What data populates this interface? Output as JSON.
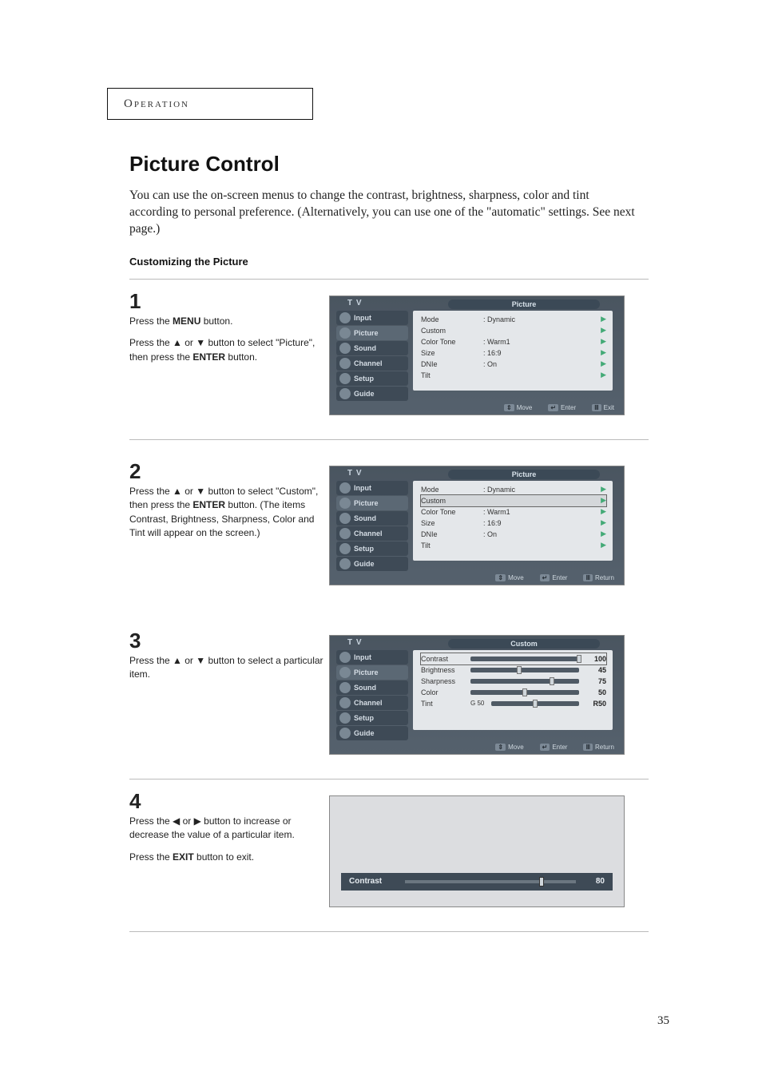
{
  "header": {
    "section": "Operation"
  },
  "title": "Picture Control",
  "intro": "You can use the on-screen menus to change the contrast, brightness, sharpness, color and tint according to personal preference. (Alternatively, you can use one of the \"automatic\" settings. See next page.)",
  "subhead": "Customizing the Picture",
  "page_number": "35",
  "symbols": {
    "up": "▲",
    "down": "▼",
    "left": "◀",
    "right": "▶",
    "play": "▶"
  },
  "sidebar": {
    "items": [
      {
        "label": "Input"
      },
      {
        "label": "Picture"
      },
      {
        "label": "Sound"
      },
      {
        "label": "Channel"
      },
      {
        "label": "Setup"
      },
      {
        "label": "Guide"
      }
    ]
  },
  "steps": [
    {
      "num": "1",
      "lines": [
        {
          "pre": "Press the ",
          "bold": "MENU",
          "post": " button."
        },
        {
          "pre": "Press the ▲ or ▼ button to select \"Picture\", then press the ",
          "bold": "ENTER",
          "post": " button."
        }
      ],
      "osd": {
        "tv": "T V",
        "title": "Picture",
        "selected_index": 0,
        "rows": [
          {
            "label": "Mode",
            "value": ":  Dynamic"
          },
          {
            "label": "Custom",
            "value": ""
          },
          {
            "label": "Color Tone",
            "value": ":  Warm1"
          },
          {
            "label": "Size",
            "value": ":  16:9"
          },
          {
            "label": "DNIe",
            "value": ":  On"
          },
          {
            "label": "Tilt",
            "value": ""
          }
        ],
        "footer": [
          {
            "key": "⇕",
            "label": "Move"
          },
          {
            "key": "↵",
            "label": "Enter"
          },
          {
            "key": "Ⅲ",
            "label": "Exit"
          }
        ]
      }
    },
    {
      "num": "2",
      "lines": [
        {
          "pre": "Press the ▲ or ▼ button to select \"Custom\", then press the ",
          "bold": "ENTER",
          "post": " button. (The items Contrast, Brightness, Sharpness, Color and Tint will appear on the screen.)"
        }
      ],
      "osd": {
        "tv": "T V",
        "title": "Picture",
        "selected_index": 1,
        "rows": [
          {
            "label": "Mode",
            "value": ":  Dynamic"
          },
          {
            "label": "Custom",
            "value": ""
          },
          {
            "label": "Color Tone",
            "value": ":  Warm1"
          },
          {
            "label": "Size",
            "value": ":  16:9"
          },
          {
            "label": "DNIe",
            "value": ":  On"
          },
          {
            "label": "Tilt",
            "value": ""
          }
        ],
        "footer": [
          {
            "key": "⇕",
            "label": "Move"
          },
          {
            "key": "↵",
            "label": "Enter"
          },
          {
            "key": "Ⅲ",
            "label": "Return"
          }
        ]
      }
    },
    {
      "num": "3",
      "lines": [
        {
          "pre": "Press the ▲ or ▼ button to select a particular item.",
          "bold": "",
          "post": ""
        }
      ],
      "osd_custom": {
        "tv": "T V",
        "title": "Custom",
        "selected_index": 0,
        "rows": [
          {
            "label": "Contrast",
            "value": 100,
            "pos": 100
          },
          {
            "label": "Brightness",
            "value": 45,
            "pos": 45
          },
          {
            "label": "Sharpness",
            "value": 75,
            "pos": 75
          },
          {
            "label": "Color",
            "value": 50,
            "pos": 50
          },
          {
            "label": "Tint",
            "left": "G 50",
            "value": "R50",
            "pos": 50
          }
        ],
        "footer": [
          {
            "key": "⇕",
            "label": "Move"
          },
          {
            "key": "↵",
            "label": "Enter"
          },
          {
            "key": "Ⅲ",
            "label": "Return"
          }
        ]
      }
    },
    {
      "num": "4",
      "lines": [
        {
          "pre": "Press the ◀ or ▶ button to increase or decrease the value of a particular item.",
          "bold": "",
          "post": ""
        },
        {
          "pre": "Press the ",
          "bold": "EXIT",
          "post": " button to exit."
        }
      ],
      "osd_bar": {
        "label": "Contrast",
        "value": "80",
        "pos": 80
      }
    }
  ]
}
